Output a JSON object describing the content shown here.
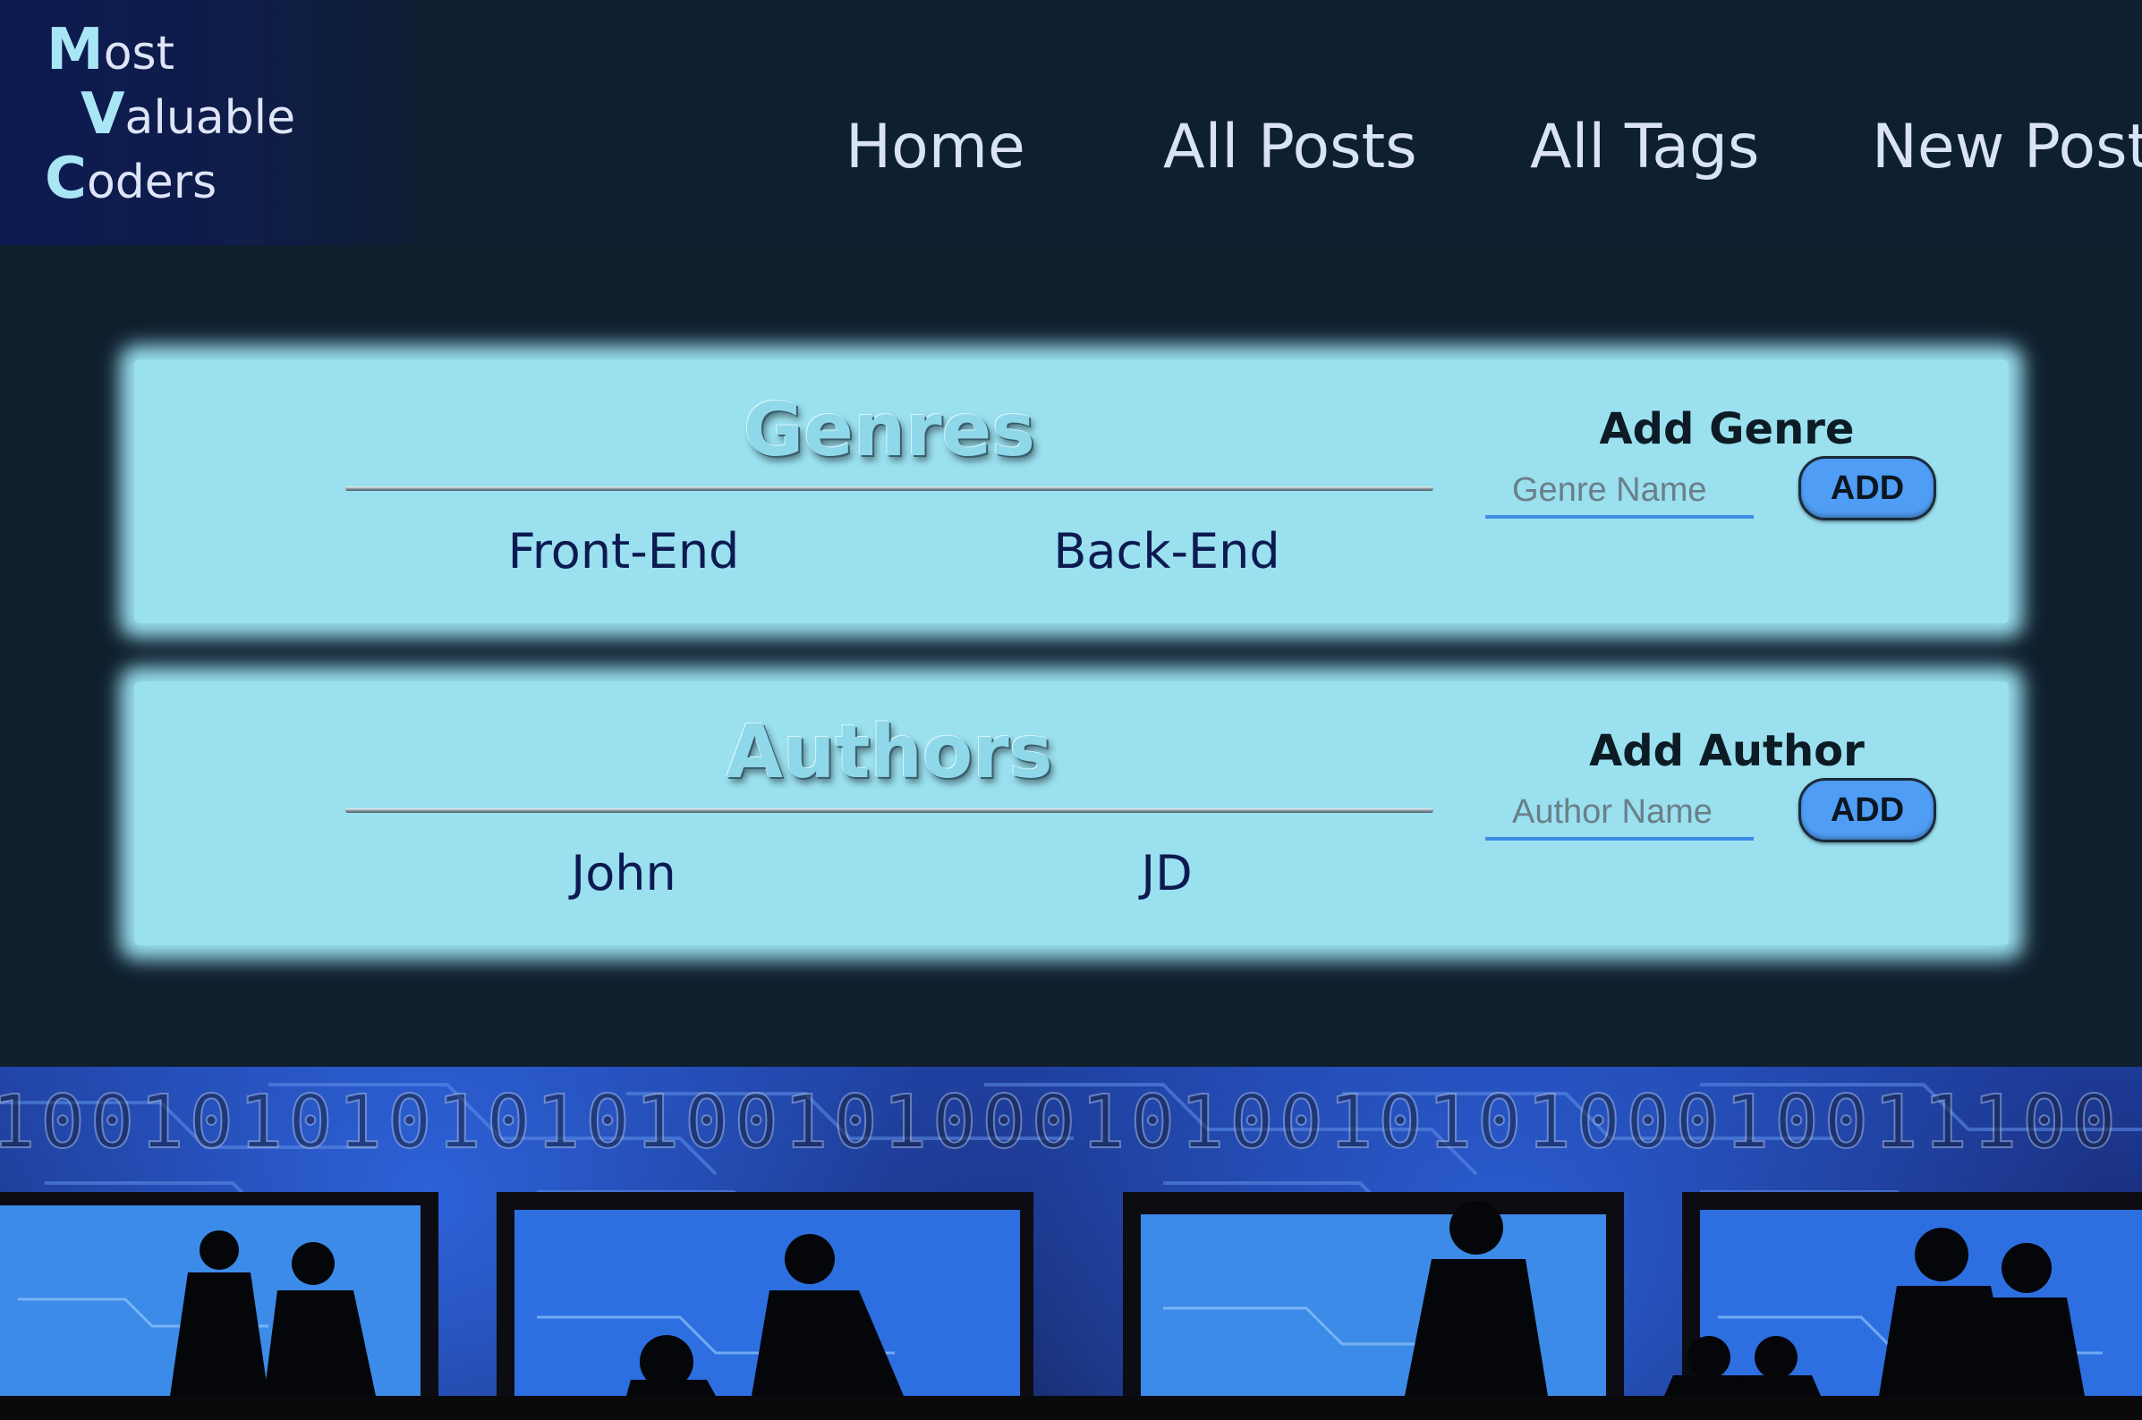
{
  "logo": {
    "line1_cap": "M",
    "line1_rest": "ost",
    "line2_cap": "V",
    "line2_rest": "aluable",
    "line3_cap": "C",
    "line3_rest": "oders"
  },
  "nav": {
    "home": "Home",
    "all_posts": "All Posts",
    "all_tags": "All Tags",
    "new_post": "New Post"
  },
  "genres": {
    "title": "Genres",
    "items": [
      "Front-End",
      "Back-End"
    ],
    "add_label": "Add Genre",
    "input_placeholder": "Genre Name",
    "button_label": "ADD"
  },
  "authors": {
    "title": "Authors",
    "items": [
      "John",
      "JD"
    ],
    "add_label": "Add Author",
    "input_placeholder": "Author Name",
    "button_label": "ADD"
  },
  "banner": {
    "binary_row": "1001010101010100101000101001010100010011100"
  },
  "colors": {
    "background": "#0f1f2e",
    "header_logo_bg": "#0d1a52",
    "card": "#9ae0ef",
    "nav_text": "#d9e2f7",
    "item_text": "#0d1a52",
    "button": "#4f9df4",
    "input_underline": "#3c8ce7"
  }
}
